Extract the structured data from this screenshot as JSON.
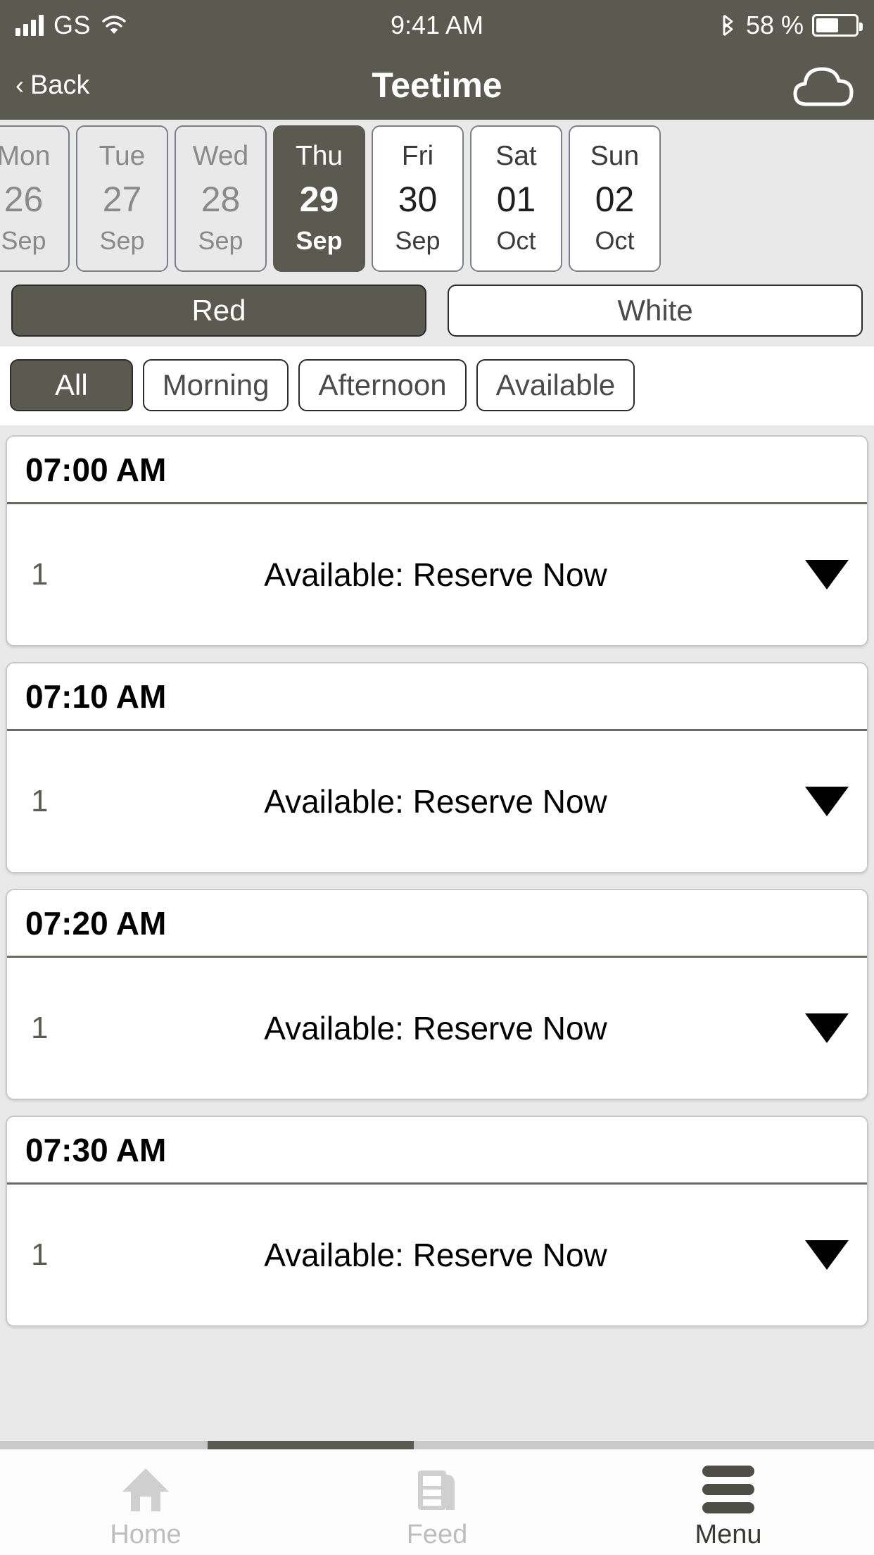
{
  "statusbar": {
    "signal_icon": "signal-bars-icon",
    "carrier": "GS",
    "wifi_icon": "wifi-icon",
    "time": "9:41 AM",
    "bluetooth_icon": "bluetooth-icon",
    "battery_pct": "58 %",
    "battery_icon": "battery-icon",
    "bar_color": "#5a5a50"
  },
  "navbar": {
    "back_chevron": "‹",
    "back_label": "Back",
    "title": "Teetime",
    "cloud_icon": "cloud-icon"
  },
  "date_strip": {
    "days": [
      {
        "dow": "Mon",
        "num": "26",
        "mon": "Sep",
        "state": "disabled"
      },
      {
        "dow": "Tue",
        "num": "27",
        "mon": "Sep",
        "state": "disabled"
      },
      {
        "dow": "Wed",
        "num": "28",
        "mon": "Sep",
        "state": "disabled"
      },
      {
        "dow": "Thu",
        "num": "29",
        "mon": "Sep",
        "state": "selected"
      },
      {
        "dow": "Fri",
        "num": "30",
        "mon": "Sep",
        "state": "enabled"
      },
      {
        "dow": "Sat",
        "num": "01",
        "mon": "Oct",
        "state": "enabled"
      },
      {
        "dow": "Sun",
        "num": "02",
        "mon": "Oct",
        "state": "enabled"
      }
    ]
  },
  "course_toggle": {
    "options": [
      {
        "label": "Red",
        "active": true
      },
      {
        "label": "White",
        "active": false
      }
    ]
  },
  "filters": {
    "options": [
      {
        "label": "All",
        "active": true
      },
      {
        "label": "Morning",
        "active": false
      },
      {
        "label": "Afternoon",
        "active": false
      },
      {
        "label": "Available",
        "active": false
      }
    ]
  },
  "teetimes": {
    "slot_status_label": "Available: Reserve Now",
    "caret_icon": "chevron-down-icon",
    "cards": [
      {
        "time": "07:00 AM",
        "slot_num": "1",
        "status": "Available: Reserve Now"
      },
      {
        "time": "07:10 AM",
        "slot_num": "1",
        "status": "Available: Reserve Now"
      },
      {
        "time": "07:20 AM",
        "slot_num": "1",
        "status": "Available: Reserve Now"
      },
      {
        "time": "07:30 AM",
        "slot_num": "1",
        "status": "Available: Reserve Now"
      }
    ]
  },
  "tabbar": {
    "tabs": [
      {
        "label": "Home",
        "icon": "home-icon",
        "active": false
      },
      {
        "label": "Feed",
        "icon": "feed-icon",
        "active": false
      },
      {
        "label": "Menu",
        "icon": "hamburger-menu-icon",
        "active": true
      }
    ]
  },
  "colors": {
    "accent": "#5a5a50",
    "page_bg": "#e9e9e9",
    "card_bg": "#ffffff",
    "muted_text": "#8a8a8a"
  }
}
